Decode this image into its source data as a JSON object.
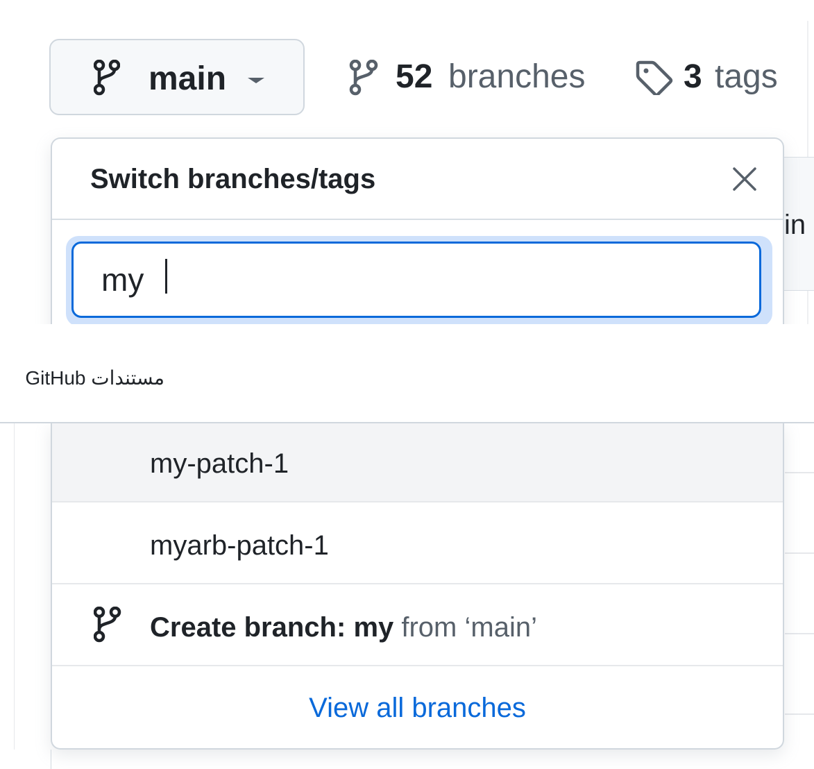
{
  "header": {
    "branch_button": {
      "current_branch": "main",
      "icon": "git-branch-icon"
    },
    "branches_link": {
      "count": "52",
      "label": "branches",
      "icon": "git-branch-icon"
    },
    "tags_link": {
      "count": "3",
      "label": "tags",
      "icon": "tag-icon"
    },
    "background_partial_text": "in"
  },
  "dropdown": {
    "title": "Switch branches/tags",
    "close_icon": "close-icon",
    "filter": {
      "value": "my"
    },
    "results": [
      {
        "label": "my-patch-1",
        "highlighted": true
      },
      {
        "label": "myarb-patch-1",
        "highlighted": false
      }
    ],
    "create_branch": {
      "prefix": "Create branch:",
      "name": "my",
      "suffix": "from ‘main’",
      "icon": "git-branch-icon"
    },
    "view_all": "View all branches"
  },
  "caption": "مستندات GitHub",
  "colors": {
    "accent_blue": "#0969da",
    "focus_ring": "#cfe1fb",
    "border": "#d0d7de",
    "text_primary": "#1f2328",
    "text_muted": "#57606a",
    "button_bg": "#f6f8fa",
    "row_hover_bg": "#f3f4f6"
  }
}
